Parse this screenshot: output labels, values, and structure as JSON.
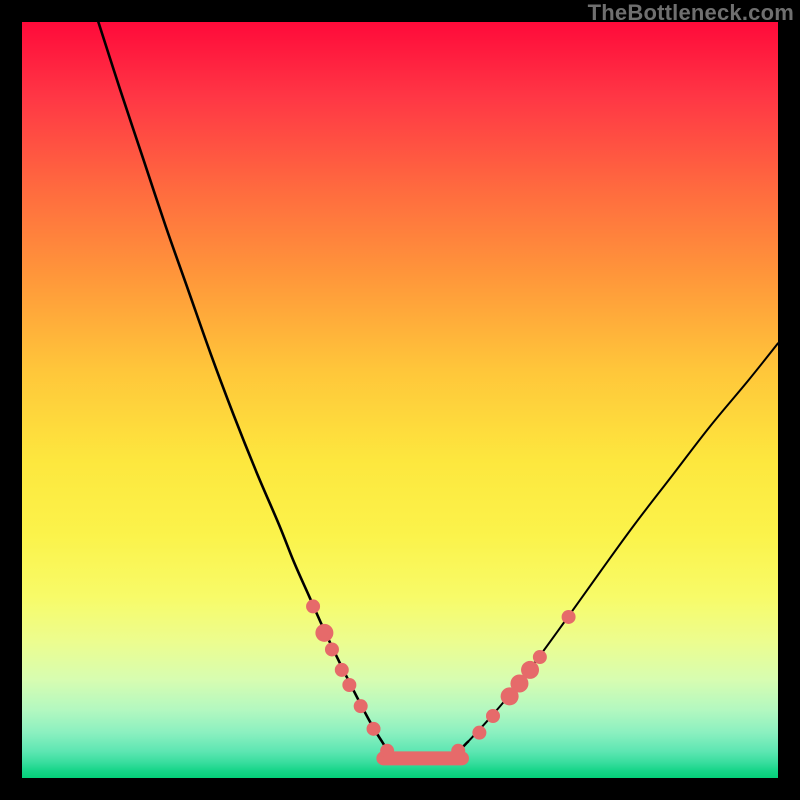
{
  "watermark": {
    "text": "TheBottleneck.com"
  },
  "chart_data": {
    "type": "line",
    "title": "",
    "xlabel": "",
    "ylabel": "",
    "xlim": [
      0,
      100
    ],
    "ylim": [
      0,
      100
    ],
    "series": [
      {
        "name": "left-curve",
        "x": [
          10.1,
          13.0,
          16.0,
          19.0,
          22.0,
          25.0,
          28.0,
          31.0,
          34.0,
          36.0,
          38.0,
          40.0,
          42.0,
          44.0,
          46.0,
          47.5,
          49.0
        ],
        "values": [
          100,
          91,
          82,
          73,
          64.5,
          56.0,
          48.0,
          40.5,
          33.5,
          28.5,
          24.0,
          19.5,
          15.3,
          11.3,
          7.5,
          5.0,
          3.0
        ]
      },
      {
        "name": "floor",
        "x": [
          49.0,
          51.0,
          53.0,
          55.0,
          57.0
        ],
        "values": [
          3.0,
          2.6,
          2.5,
          2.6,
          3.0
        ]
      },
      {
        "name": "right-curve",
        "x": [
          57.0,
          59.0,
          61.5,
          64.5,
          68.0,
          72.0,
          76.5,
          81.0,
          86.0,
          91.0,
          96.0,
          100.0
        ],
        "values": [
          3.0,
          4.8,
          7.5,
          11.0,
          15.5,
          21.0,
          27.3,
          33.5,
          40.0,
          46.5,
          52.5,
          57.5
        ]
      }
    ],
    "markers": {
      "name": "highlight-dots",
      "color": "#e66a6a",
      "points": [
        {
          "x": 38.5,
          "y": 22.7,
          "r": 7
        },
        {
          "x": 40.0,
          "y": 19.2,
          "r": 9
        },
        {
          "x": 41.0,
          "y": 17.0,
          "r": 7
        },
        {
          "x": 42.3,
          "y": 14.3,
          "r": 7
        },
        {
          "x": 43.3,
          "y": 12.3,
          "r": 7
        },
        {
          "x": 44.8,
          "y": 9.5,
          "r": 7
        },
        {
          "x": 46.5,
          "y": 6.5,
          "r": 7
        },
        {
          "x": 48.3,
          "y": 3.6,
          "r": 7
        },
        {
          "x": 57.7,
          "y": 3.6,
          "r": 7
        },
        {
          "x": 60.5,
          "y": 6.0,
          "r": 7
        },
        {
          "x": 62.3,
          "y": 8.2,
          "r": 7
        },
        {
          "x": 64.5,
          "y": 10.8,
          "r": 9
        },
        {
          "x": 65.8,
          "y": 12.5,
          "r": 9
        },
        {
          "x": 67.2,
          "y": 14.3,
          "r": 9
        },
        {
          "x": 68.5,
          "y": 16.0,
          "r": 7
        },
        {
          "x": 72.3,
          "y": 21.3,
          "r": 7
        }
      ]
    },
    "floor_bar": {
      "color": "#e66a6a",
      "x0": 47.8,
      "x1": 58.2,
      "y": 2.6,
      "thickness_px": 14
    }
  }
}
